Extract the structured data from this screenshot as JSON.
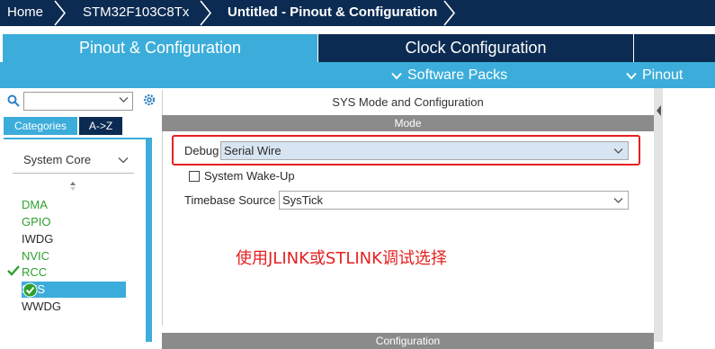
{
  "breadcrumb": {
    "items": [
      "Home",
      "STM32F103C8Tx",
      "Untitled - Pinout & Configuration"
    ]
  },
  "tabs": {
    "pinout_config": "Pinout & Configuration",
    "clock_config": "Clock Configuration"
  },
  "subbar": {
    "software_packs": "Software Packs",
    "pinout": "Pinout"
  },
  "left": {
    "search_value": "",
    "tab_categories": "Categories",
    "tab_az": "A->Z",
    "group": "System Core",
    "items": [
      {
        "label": "DMA",
        "status": "green"
      },
      {
        "label": "GPIO",
        "status": "green"
      },
      {
        "label": "IWDG",
        "status": "default"
      },
      {
        "label": "NVIC",
        "status": "green"
      },
      {
        "label": "RCC",
        "status": "checked"
      },
      {
        "label": "SYS",
        "status": "selected"
      },
      {
        "label": "WWDG",
        "status": "default"
      }
    ]
  },
  "right": {
    "title": "SYS Mode and Configuration",
    "mode_header": "Mode",
    "debug_label": "Debug",
    "debug_value": "Serial Wire",
    "wakeup_label": "System Wake-Up",
    "wakeup_checked": false,
    "timebase_label": "Timebase Source",
    "timebase_value": "SysTick",
    "config_header": "Configuration"
  },
  "annotation": "使用JLINK或STLINK调试选择",
  "colors": {
    "navy": "#0b2b52",
    "accent": "#3cadda",
    "annotation_red": "#e52020",
    "ok_green": "#2ea02e"
  }
}
